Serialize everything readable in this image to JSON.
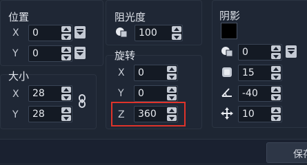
{
  "position": {
    "title": "位置",
    "x": {
      "label": "X",
      "value": "0"
    },
    "y": {
      "label": "Y",
      "value": "0"
    }
  },
  "size": {
    "title": "大小",
    "w": {
      "label": "X",
      "value": "28"
    },
    "h": {
      "label": "Y",
      "value": "28"
    }
  },
  "opacity": {
    "title": "阻光度",
    "value": "100"
  },
  "rotation": {
    "title": "旋转",
    "x": {
      "label": "X",
      "value": "0"
    },
    "y": {
      "label": "Y",
      "value": "0"
    },
    "z": {
      "label": "Z",
      "value": "360"
    }
  },
  "shadow": {
    "title": "阴影",
    "color": "#000000",
    "opacity_value": "0",
    "blur_value": "15",
    "angle_value": "-40",
    "distance_value": "10"
  },
  "footer": {
    "save_label": "保存"
  }
}
